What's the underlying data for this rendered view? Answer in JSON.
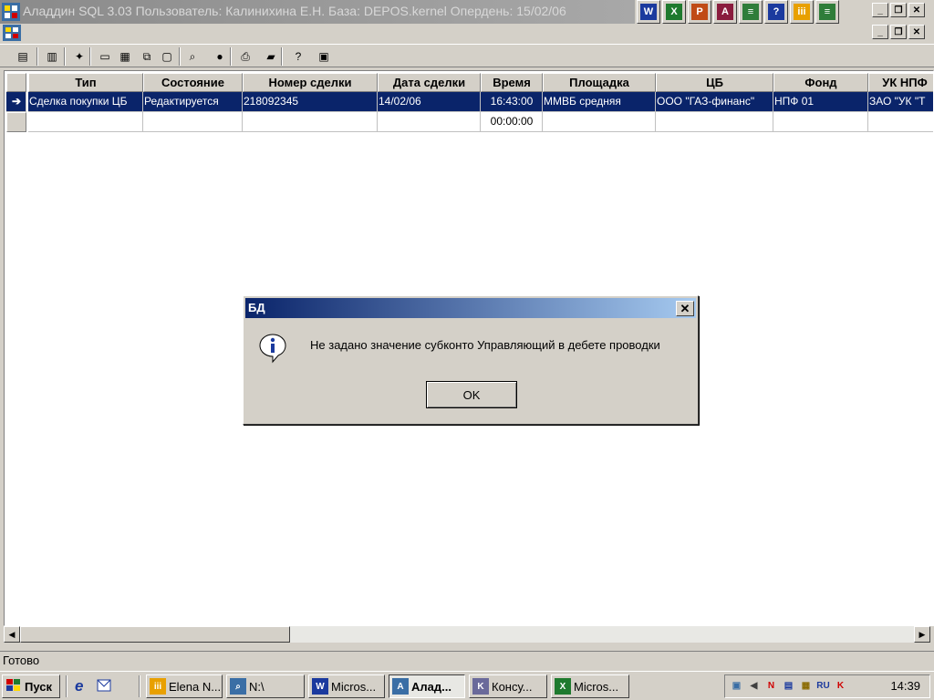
{
  "window": {
    "title": "Аладдин SQL 3.03 Пользователь: Калинихина Е.Н. База: DEPOS.kernel Опердень: 15/02/06",
    "min_glyph": "_",
    "restore_glyph": "❐",
    "close_glyph": "✕"
  },
  "office_bar": [
    {
      "name": "word-icon",
      "glyph": "W",
      "color": "#1b3a9e"
    },
    {
      "name": "excel-icon",
      "glyph": "X",
      "color": "#1e7a2e"
    },
    {
      "name": "powerpoint-icon",
      "glyph": "P",
      "color": "#c04b16"
    },
    {
      "name": "access-icon",
      "glyph": "A",
      "color": "#8a1c3e"
    },
    {
      "name": "spreadsheet-icon",
      "glyph": "≡",
      "color": "#2f7d3a"
    },
    {
      "name": "help-icon",
      "glyph": "?",
      "color": "#1b3a9e"
    },
    {
      "name": "consultant-icon",
      "glyph": "iii",
      "color": "#e8a000"
    },
    {
      "name": "excel-sheet-icon",
      "glyph": "≡",
      "color": "#2f7d3a"
    }
  ],
  "toolbar": [
    {
      "name": "list-icon",
      "glyph": "▤"
    },
    {
      "name": "database-icon",
      "glyph": "▥"
    },
    {
      "name": "find-record-icon",
      "glyph": "✦"
    },
    {
      "name": "single-window-icon",
      "glyph": "▭"
    },
    {
      "name": "tile-windows-icon",
      "glyph": "▦"
    },
    {
      "name": "cascade-windows-icon",
      "glyph": "⧉"
    },
    {
      "name": "form-icon",
      "glyph": "▢"
    },
    {
      "name": "binoculars-icon",
      "glyph": "⌕"
    },
    {
      "name": "stop-icon",
      "glyph": "●"
    },
    {
      "name": "print-icon",
      "glyph": "⎙"
    },
    {
      "name": "report-icon",
      "glyph": "▰"
    },
    {
      "name": "help-icon",
      "glyph": "?"
    },
    {
      "name": "calculator-icon",
      "glyph": "▣"
    }
  ],
  "grid": {
    "columns": [
      "Тип",
      "Состояние",
      "Номер сделки",
      "Дата сделки",
      "Время",
      "Площадка",
      "ЦБ",
      "Фонд",
      "УК НПФ"
    ],
    "rows": [
      [
        "Сделка покупки ЦБ",
        "Редактируется",
        "218092345",
        "14/02/06",
        "16:43:00",
        "ММВБ средняя",
        "ООО \"ГАЗ-финанс\"",
        "НПФ 01",
        "ЗАО \"УК \"Т"
      ],
      [
        "",
        "",
        "",
        "",
        "00:00:00",
        "",
        "",
        "",
        ""
      ]
    ],
    "current_row_indicator": "➔"
  },
  "status": {
    "text": "Готово"
  },
  "dialog": {
    "title": "БД",
    "message": "Не задано значение субконто Управляющий в дебете проводки",
    "ok_label": "OK",
    "icon": "information-icon",
    "close_glyph": "✕"
  },
  "taskbar": {
    "start_label": "Пуск",
    "tasks": [
      {
        "name": "task-elena",
        "label": "Elena N...",
        "icon": "consultant-icon",
        "color": "#e8a000",
        "glyph": "iii",
        "active": false
      },
      {
        "name": "task-explorer",
        "label": "N:\\",
        "icon": "folder-search-icon",
        "color": "#3a6ea5",
        "glyph": "⌕",
        "active": false
      },
      {
        "name": "task-word",
        "label": "Micros...",
        "icon": "word-icon",
        "color": "#1b3a9e",
        "glyph": "W",
        "active": false
      },
      {
        "name": "task-aladdin",
        "label": "Алад...",
        "icon": "aladdin-icon",
        "color": "#3a6ea5",
        "glyph": "A",
        "active": true
      },
      {
        "name": "task-consultant",
        "label": "Консу...",
        "icon": "consultant-plus-icon",
        "color": "#6a6a9a",
        "glyph": "K",
        "active": false
      },
      {
        "name": "task-excel",
        "label": "Micros...",
        "icon": "excel-icon",
        "color": "#1e7a2e",
        "glyph": "X",
        "active": false
      }
    ],
    "tray_icons": [
      {
        "name": "network-icon",
        "glyph": "▣",
        "color": "#3a6ea5"
      },
      {
        "name": "volume-icon",
        "glyph": "◀",
        "color": "#404040"
      },
      {
        "name": "norton-icon",
        "glyph": "N",
        "color": "#d00000"
      },
      {
        "name": "monitor-icon",
        "glyph": "▤",
        "color": "#1b3a9e"
      },
      {
        "name": "scheduler-icon",
        "glyph": "▦",
        "color": "#8a6a00"
      },
      {
        "name": "keyboard-layout-icon",
        "glyph": "RU",
        "color": "#1b3a9e"
      },
      {
        "name": "kaspersky-icon",
        "glyph": "K",
        "color": "#d00000"
      }
    ],
    "clock": "14:39"
  }
}
